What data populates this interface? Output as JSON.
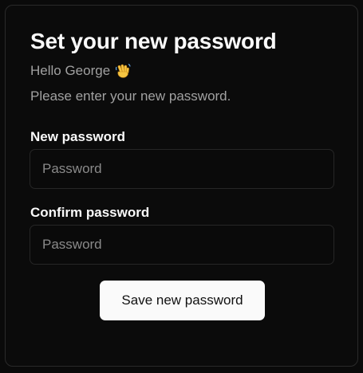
{
  "card": {
    "title": "Set your new password",
    "greeting": "Hello George",
    "greeting_icon": "waving-hand-icon",
    "subtitle": "Please enter your new password."
  },
  "form": {
    "new_password": {
      "label": "New password",
      "placeholder": "Password",
      "value": ""
    },
    "confirm_password": {
      "label": "Confirm password",
      "placeholder": "Password",
      "value": ""
    },
    "submit_label": "Save new password"
  },
  "colors": {
    "background": "#0a0a0a",
    "card_border": "#2a2a2a",
    "text_primary": "#fafafa",
    "text_muted": "#a1a1a1",
    "button_bg": "#fafafa",
    "button_text": "#111111"
  }
}
